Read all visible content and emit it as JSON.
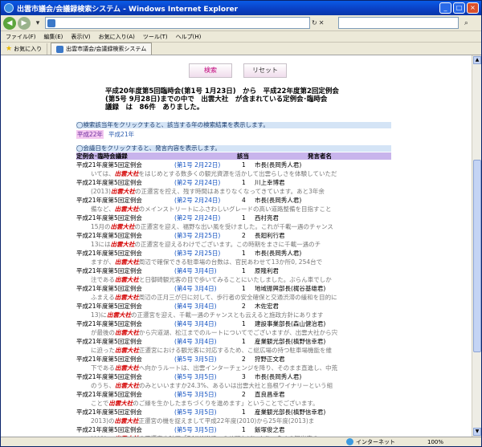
{
  "window": {
    "title": "出雲市議会/会議録検索システム - Windows Internet Explorer"
  },
  "menu": [
    "ファイル(F)",
    "編集(E)",
    "表示(V)",
    "お気に入り(A)",
    "ツール(T)",
    "ヘルプ(H)"
  ],
  "favorites_label": "お気に入り",
  "tab_title": "出雲市議会/会議録検索システム",
  "status": {
    "zone": "インターネット",
    "zoom": "100%"
  },
  "buttons": {
    "search": "検索",
    "reset": "リセット"
  },
  "summary": {
    "line1": "平成20年度第5回臨時会(第1号 1月23日)　から　平成22年度第2回定例会",
    "line2": "(第5号 9月28日)までの中で　出雲大社　が含まれている定例会･臨時会",
    "line3": "議録　は　86件　ありました。"
  },
  "section1": "◯検索該当年をクリックすると、該当する年の検索結果を表示します。",
  "years": {
    "selected": "平成22年",
    "other": "平成21年"
  },
  "section2": "◯会議日をクリックすると、発言内容を表示します。",
  "table_header": {
    "meeting": "定例会･臨時会議録",
    "hit": "該当",
    "speaker": "発言者名"
  },
  "rows": [
    {
      "meeting": "平成21年度第5回定例会",
      "date": "第1号 2月22日",
      "count": "1",
      "speaker": "市長(長岡秀人君)",
      "pre": "いては、",
      "kw": "出雲大社",
      "post": "をはじめとする数多くの観光資源を活かして出雲らしさを体験していただ"
    },
    {
      "meeting": "平成21年度第5回定例会",
      "date": "第2号 2月24日",
      "count": "1",
      "speaker": "川上幸博君",
      "pre": "(2013)",
      "kw": "出雲大社",
      "post": "の正遷宮を控え、残す時間はあまりなくなってきています。あと3年余"
    },
    {
      "meeting": "平成21年度第5回定例会",
      "date": "第2号 2月24日",
      "count": "4",
      "speaker": "市長(長岡秀人君)",
      "pre": "備など、",
      "kw": "出雲大社",
      "post": "のメインストリートにふさわしいグレードの高い道路整備を目指すこと"
    },
    {
      "meeting": "平成21年度第5回定例会",
      "date": "第2号 2月24日",
      "count": "1",
      "speaker": "西村亮君",
      "pre": "15月の",
      "kw": "出雲大社",
      "post": "の正遷宮を迎え、福野な出い風を受けました。これが千載一遇のチャンス"
    },
    {
      "meeting": "平成21年度第5回定例会",
      "date": "第3号 2月25日",
      "count": "2",
      "speaker": "長廻利行君",
      "pre": "13には",
      "kw": "出雲大社",
      "post": "の正遷宮を迎えるわけでございます。この時期をまさに千載一遇のチ"
    },
    {
      "meeting": "平成21年度第5回定例会",
      "date": "第3号 2月25日",
      "count": "1",
      "speaker": "市長(長岡秀人君)",
      "pre": "ますが、",
      "kw": "出雲大社",
      "post": "周辺で確保できる駐車場の台数は、官民あわせて13か所0, 254台で"
    },
    {
      "meeting": "平成21年度第5回定例会",
      "date": "第4号 3月4日",
      "count": "1",
      "speaker": "原隆利君",
      "pre": "注である",
      "kw": "出雲大社",
      "post": "と日御碕観光客の目で歩いてみることにいたしました。ぶらん車でしか"
    },
    {
      "meeting": "平成21年度第5回定例会",
      "date": "第4号 3月4日",
      "count": "1",
      "speaker": "地域振興部長(梶谷基雄君)",
      "pre": "ふまえる",
      "kw": "出雲大社",
      "post": "周辺の正月三が日に対して、歩行者の安全確保と交通渋滞の緩和を目的に"
    },
    {
      "meeting": "平成21年度第5回定例会",
      "date": "第4号 3月4日",
      "count": "2",
      "speaker": "木佐宏君",
      "pre": "13)に",
      "kw": "出雲大社",
      "post": "の正遷宮を迎え、千載一遇のチャンスとも云えると施政方針にあります"
    },
    {
      "meeting": "平成21年度第5回定例会",
      "date": "第4号 3月4日",
      "count": "1",
      "speaker": "建設事業部長(森山健治君)",
      "pre": "が最後の",
      "kw": "出雲大社",
      "post": "から宍道湖、松江までのルートについてでございますが、出雲大社から宍"
    },
    {
      "meeting": "平成21年度第5回定例会",
      "date": "第4号 3月4日",
      "count": "1",
      "speaker": "産業観光部長(槙野信幸君)",
      "pre": "に迫った",
      "kw": "出雲大社",
      "post": "正遷宮における観光客に対応するため、こ総広場の持つ駐車場機能を維"
    },
    {
      "meeting": "平成21年度第5回定例会",
      "date": "第5号 3月5日",
      "count": "2",
      "speaker": "狩野正文君",
      "pre": "下である",
      "kw": "出雲大社",
      "post": "へ向かうルートは、出雲インターチェンジを降り、そのまま直進し、中荒"
    },
    {
      "meeting": "平成21年度第5回定例会",
      "date": "第5号 3月5日",
      "count": "3",
      "speaker": "市長(長岡秀人君)",
      "pre": "のうち、",
      "kw": "出雲大社",
      "post": "のみといいますか24.3%、あるいは出雲大社と島根ワイナリーという組"
    },
    {
      "meeting": "平成21年度第5回定例会",
      "date": "第5号 3月5日",
      "count": "2",
      "speaker": "直良昌幸君",
      "pre": "ことで",
      "kw": "出雲大社",
      "post": "のご縁を生かしたまちづくりを進めます」ということでございます。"
    },
    {
      "meeting": "平成21年度第5回定例会",
      "date": "第5号 3月5日",
      "count": "1",
      "speaker": "産業観光部長(槙野信幸君)",
      "pre": "2013)の",
      "kw": "出雲大社",
      "post": "正遷宮の機を捉えまして平成22年度(2010)から25年度(2013)ま"
    },
    {
      "meeting": "平成21年度第5回定例会",
      "date": "第5号 3月5日",
      "count": "1",
      "speaker": "飯塚俊之君",
      "pre": "けども、",
      "kw": "出雲大社",
      "post": "の正遷宮や映画「RAILWAYS」の公開などにより、多くの観光客の"
    }
  ]
}
